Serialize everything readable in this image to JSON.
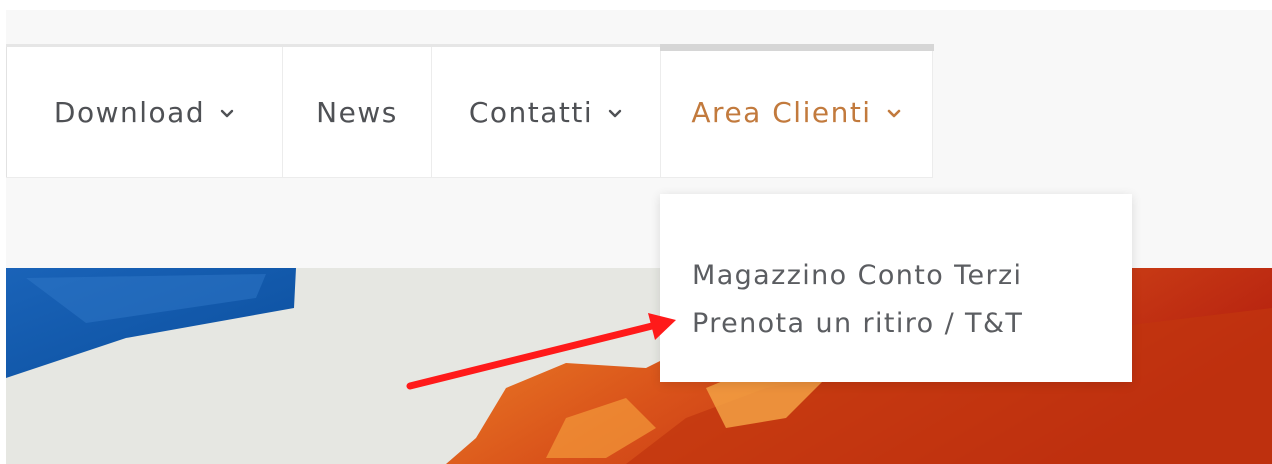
{
  "nav": {
    "items": [
      {
        "label": "Download",
        "has_dropdown": true,
        "active": false
      },
      {
        "label": "News",
        "has_dropdown": false,
        "active": false
      },
      {
        "label": "Contatti",
        "has_dropdown": true,
        "active": false
      },
      {
        "label": "Area Clienti",
        "has_dropdown": true,
        "active": true
      }
    ]
  },
  "dropdown": {
    "items": [
      {
        "label": "Magazzino Conto Terzi"
      },
      {
        "label": "Prenota un ritiro / T&T"
      }
    ]
  },
  "colors": {
    "nav_text": "#4f5155",
    "active_text": "#c27a3d",
    "dropdown_text": "#5b5d61",
    "annotation_arrow": "#ff1a1a"
  },
  "icons": {
    "chevron": "chevron-down-icon"
  }
}
